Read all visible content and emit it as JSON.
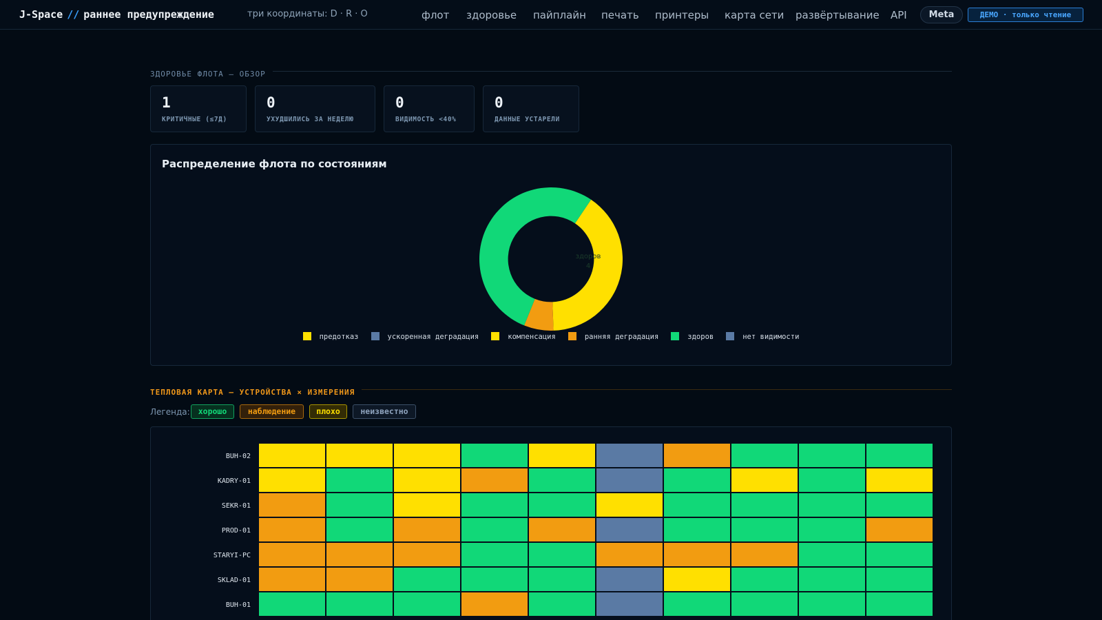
{
  "header": {
    "brand_name": "J-Space",
    "brand_sep": "//",
    "brand_suffix": "раннее предупреждение",
    "subtitle": "три координаты: D · R · O",
    "nav": [
      "флот",
      "здоровье",
      "пайплайн",
      "печать",
      "принтеры",
      "карта сети",
      "развёртывание",
      "API"
    ],
    "meta_button": "Meta",
    "demo_badge": "ДЕМО · только чтение"
  },
  "overview": {
    "title": "ЗДОРОВЬЕ ФЛОТА — ОБЗОР",
    "kpis": [
      {
        "value": "1",
        "label": "КРИТИЧНЫЕ (≤7Д)"
      },
      {
        "value": "0",
        "label": "УХУДШИЛИСЬ ЗА НЕДЕЛЮ"
      },
      {
        "value": "0",
        "label": "ВИДИМОСТЬ <40%"
      },
      {
        "value": "0",
        "label": "ДАННЫЕ УСТАРЕЛИ"
      }
    ]
  },
  "chart_data": {
    "type": "pie",
    "title": "Распределение флота по состояниям",
    "hole": 0.6,
    "slices": [
      {
        "label": "предотказ",
        "value": 0,
        "color": "#ffe000"
      },
      {
        "label": "ускоренная деградация",
        "value": 0,
        "color": "#5a7aa4"
      },
      {
        "label": "компенсация",
        "value": 3,
        "color": "#ffe000"
      },
      {
        "label": "ранняя деградация",
        "value": 0.5,
        "color": "#f29c11"
      },
      {
        "label": "здоров",
        "value": 4,
        "color": "#11d878"
      },
      {
        "label": "нет видимости",
        "value": 0,
        "color": "#5a7aa4"
      }
    ],
    "data_labels": [
      {
        "label": "здоров",
        "value": "4"
      }
    ],
    "legend_position": "bottom"
  },
  "heatmap": {
    "title": "ТЕПЛОВАЯ КАРТА — УСТРОЙСТВА × ИЗМЕРЕНИЯ",
    "legend_label": "Легенда:",
    "legend": [
      {
        "key": "good",
        "label": "хорошо",
        "color": "#11d878",
        "bg": "#06301f",
        "border": "#11a35f"
      },
      {
        "key": "watch",
        "label": "наблюдение",
        "color": "#f29c11",
        "bg": "#33200a",
        "border": "#a8680d"
      },
      {
        "key": "bad",
        "label": "плохо",
        "color": "#ffe000",
        "bg": "#332c05",
        "border": "#a99500"
      },
      {
        "key": "unknown",
        "label": "неизвестно",
        "color": "#8ea3bd",
        "bg": "#0d1826",
        "border": "#3c5068"
      }
    ],
    "colors": {
      "good": "#11d878",
      "watch": "#f29c11",
      "bad": "#ffe000",
      "unknown": "#5a7aa4"
    },
    "rows": [
      {
        "device": "BUH-02",
        "cells": [
          "bad",
          "bad",
          "bad",
          "good",
          "bad",
          "unknown",
          "watch",
          "good",
          "good",
          "good"
        ]
      },
      {
        "device": "KADRY-01",
        "cells": [
          "bad",
          "good",
          "bad",
          "watch",
          "good",
          "unknown",
          "good",
          "bad",
          "good",
          "bad"
        ]
      },
      {
        "device": "SEKR-01",
        "cells": [
          "watch",
          "good",
          "bad",
          "good",
          "good",
          "bad",
          "good",
          "good",
          "good",
          "good"
        ]
      },
      {
        "device": "PROD-01",
        "cells": [
          "watch",
          "good",
          "watch",
          "good",
          "watch",
          "unknown",
          "good",
          "good",
          "good",
          "watch"
        ]
      },
      {
        "device": "STARYI-PC",
        "cells": [
          "watch",
          "watch",
          "watch",
          "good",
          "good",
          "watch",
          "watch",
          "watch",
          "good",
          "good"
        ]
      },
      {
        "device": "SKLAD-01",
        "cells": [
          "watch",
          "watch",
          "good",
          "good",
          "good",
          "unknown",
          "bad",
          "good",
          "good",
          "good"
        ]
      },
      {
        "device": "BUH-01",
        "cells": [
          "good",
          "good",
          "good",
          "watch",
          "good",
          "unknown",
          "good",
          "good",
          "good",
          "good"
        ]
      }
    ]
  }
}
